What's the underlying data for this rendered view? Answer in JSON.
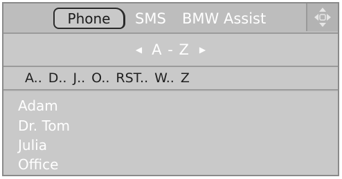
{
  "tabs": {
    "active": "Phone",
    "items": [
      {
        "label": "Phone"
      },
      {
        "label": "SMS"
      },
      {
        "label": "BMW Assist"
      }
    ]
  },
  "controller_icon": "four-way-controller-icon",
  "sort": {
    "label": "A - Z",
    "prev_icon": "left-arrow-icon",
    "next_icon": "right-arrow-icon"
  },
  "index": [
    "A..",
    "D..",
    "J..",
    "O..",
    "RST..",
    "W..",
    "Z"
  ],
  "contacts": [
    "Adam",
    "Dr. Tom",
    "Julia",
    "Office"
  ],
  "colors": {
    "panel": "#c9c9c9",
    "header": "#bdbdbd",
    "text_light": "#ffffff",
    "text_dark": "#1f1f1f"
  }
}
